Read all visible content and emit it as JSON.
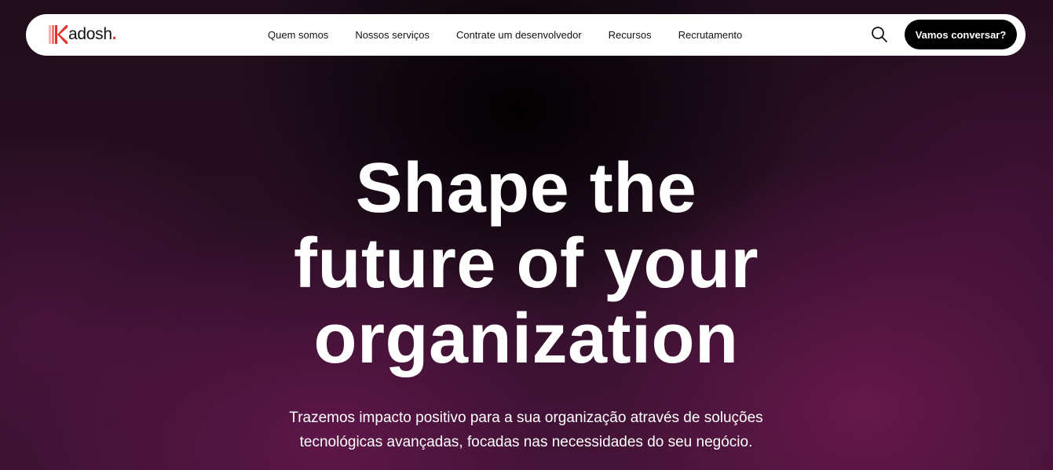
{
  "brand": {
    "name": "adosh",
    "dot": ".",
    "accent_color": "#e0352b"
  },
  "nav": {
    "items": [
      {
        "label": "Quem somos"
      },
      {
        "label": "Nossos serviços"
      },
      {
        "label": "Contrate um desenvolvedor"
      },
      {
        "label": "Recursos"
      },
      {
        "label": "Recrutamento"
      }
    ],
    "search_icon": "search-icon",
    "cta_label": "Vamos conversar?"
  },
  "hero": {
    "headline_lines": [
      "Shape the",
      "future of your",
      "organization"
    ],
    "subtitle": "Trazemos impacto positivo para a sua organização através de soluções tecnológicas avançadas, focadas nas necessidades do seu negócio.",
    "colors": {
      "background_dark": "#1c0b17",
      "glow": "#761a56",
      "text": "#ffffff"
    }
  }
}
